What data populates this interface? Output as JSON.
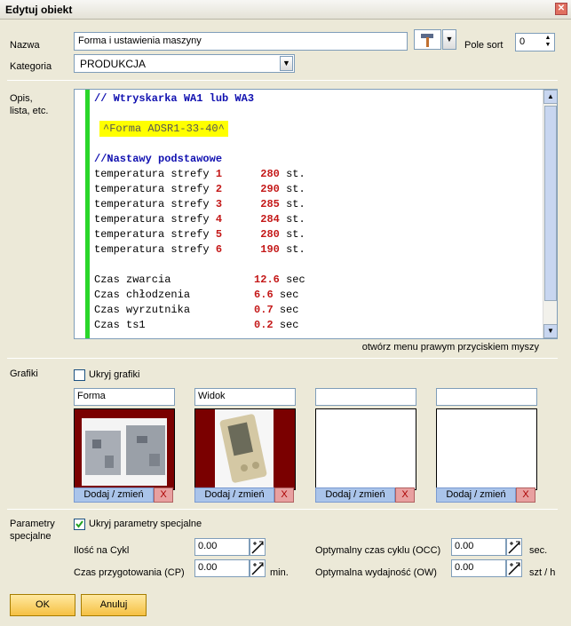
{
  "window": {
    "title": "Edytuj obiekt"
  },
  "name": {
    "label": "Nazwa",
    "value": "Forma i ustawienia maszyny"
  },
  "sort": {
    "label": "Pole sort",
    "value": "0"
  },
  "category": {
    "label": "Kategoria",
    "value": "PRODUKCJA"
  },
  "description": {
    "label": "Opis,\nlista, etc.",
    "hint": "otwórz menu prawym przyciskiem myszy",
    "line1": "// Wtryskarka WA1 lub WA3",
    "mold_highlight": "^Forma ADSR1-33-40^",
    "section": "//Nastawy podstawowe",
    "temps": [
      {
        "label": "temperatura strefy ",
        "zone": "1",
        "value": "280",
        "unit": "st."
      },
      {
        "label": "temperatura strefy ",
        "zone": "2",
        "value": "290",
        "unit": "st."
      },
      {
        "label": "temperatura strefy ",
        "zone": "3",
        "value": "285",
        "unit": "st."
      },
      {
        "label": "temperatura strefy ",
        "zone": "4",
        "value": "284",
        "unit": "st."
      },
      {
        "label": "temperatura strefy ",
        "zone": "5",
        "value": "280",
        "unit": "st."
      },
      {
        "label": "temperatura strefy ",
        "zone": "6",
        "value": "190",
        "unit": "st."
      }
    ],
    "times": [
      {
        "label": "Czas zwarcia",
        "value": "12.6",
        "unit": "sec"
      },
      {
        "label": "Czas chłodzenia",
        "value": "6.6",
        "unit": "sec"
      },
      {
        "label": "Czas wyrzutnika",
        "value": "0.7",
        "unit": "sec"
      },
      {
        "label": "Czas ts1",
        "value": "0.2",
        "unit": "sec"
      }
    ]
  },
  "graphics": {
    "label": "Grafiki",
    "hide_label": "Ukryj grafiki",
    "slots": [
      {
        "name": "Forma",
        "button": "Dodaj / zmień",
        "remove": "X"
      },
      {
        "name": "Widok",
        "button": "Dodaj / zmień",
        "remove": "X"
      },
      {
        "name": "",
        "button": "Dodaj / zmień",
        "remove": "X"
      },
      {
        "name": "",
        "button": "Dodaj / zmień",
        "remove": "X"
      }
    ]
  },
  "params": {
    "label": "Parametry\nspecjalne",
    "hide_label": "Ukryj parametry specjalne",
    "qty_label": "Ilość na Cykl",
    "qty_value": "0.00",
    "prep_label": "Czas przygotowania  (CP)",
    "prep_value": "0.00",
    "prep_unit": "min.",
    "occ_label": "Optymalny czas cyklu  (OCC)",
    "occ_value": "0.00",
    "occ_unit": "sec.",
    "ow_label": "Optymalna wydajność  (OW)",
    "ow_value": "0.00",
    "ow_unit": "szt / h"
  },
  "buttons": {
    "ok": "OK",
    "cancel": "Anuluj"
  }
}
